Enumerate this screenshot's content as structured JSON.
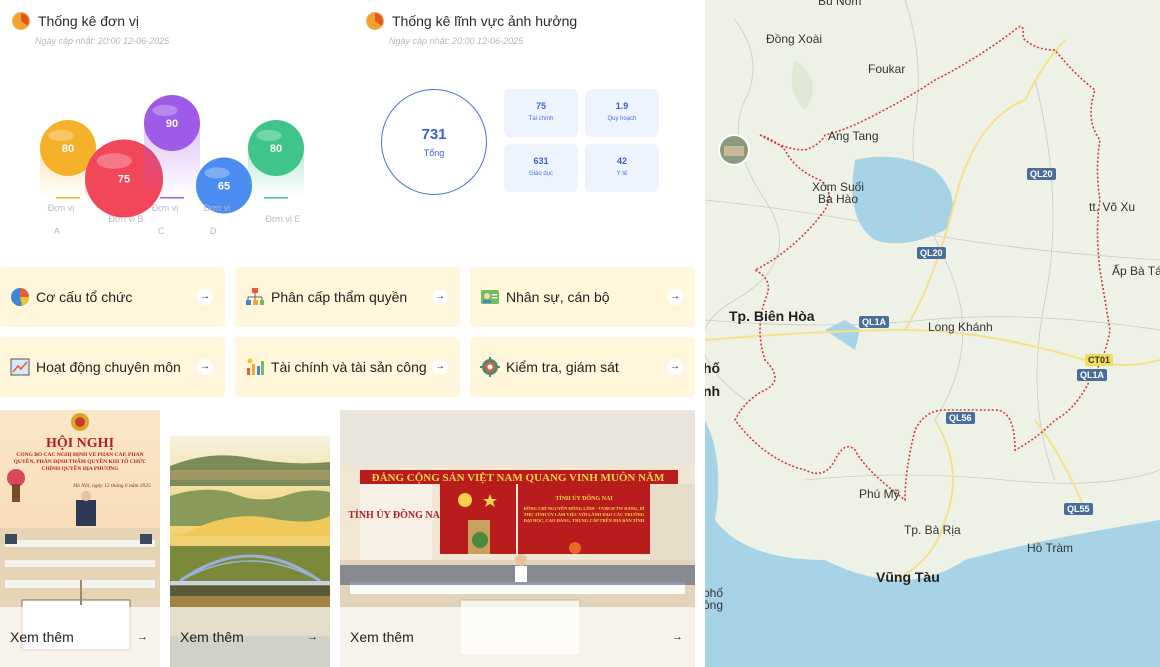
{
  "unit_stats": {
    "title": "Thống kê đơn vị",
    "updated": "Ngày cập nhật: 20:00 12-06-2025",
    "chart_data": {
      "type": "bar",
      "categories": [
        "Đơn vị A",
        "Đơn vị B",
        "Đơn vị C",
        "Đơn vị D",
        "Đơn vị E"
      ],
      "values": [
        80,
        75,
        90,
        65,
        80
      ],
      "colors": [
        "#f6b12a",
        "#f2465b",
        "#9f5ae8",
        "#4a8cf0",
        "#3fc48a"
      ],
      "ylim": [
        0,
        100
      ],
      "title": "",
      "xlabel": "",
      "ylabel": ""
    }
  },
  "field_stats": {
    "title": "Thống kê lĩnh vực ảnh hưởng",
    "updated": "Ngày cập nhật: 20:00 12-06-2025",
    "total_value": "731",
    "total_label": "Tổng",
    "items": [
      {
        "value": "75",
        "label": "Tài chính"
      },
      {
        "value": "1.9",
        "label": "Quy hoạch"
      },
      {
        "value": "631",
        "label": "Giáo dục"
      },
      {
        "value": "42",
        "label": "Y tế"
      }
    ]
  },
  "menu": [
    {
      "label": "Cơ cấu tổ chức",
      "icon": "pie-chart-icon"
    },
    {
      "label": "Phân cấp thẩm quyền",
      "icon": "org-hierarchy-icon"
    },
    {
      "label": "Nhân sự, cán bộ",
      "icon": "staff-card-icon"
    },
    {
      "label": "Hoạt động chuyên môn",
      "icon": "line-chart-icon"
    },
    {
      "label": "Tài chính và tài sản công",
      "icon": "finance-chart-icon"
    },
    {
      "label": "Kiểm tra, giám sát",
      "icon": "inspection-gear-icon"
    }
  ],
  "menu_arrow": "→",
  "cards": [
    {
      "more_label": "Xem thêm",
      "banner_title": "HỘI NGHỊ",
      "banner_sub": "CÔNG BỐ CÁC NGHỊ ĐỊNH VỀ PHÂN CẤP, PHÂN QUYỀN, PHÂN ĐỊNH THẨM QUYỀN KHI TỔ CHỨC CHÍNH QUYỀN ĐỊA PHƯƠNG",
      "banner_date": "Hà Nội, ngày 12 tháng 6 năm 2025"
    },
    {
      "more_label": "Xem thêm"
    },
    {
      "more_label": "Xem thêm",
      "banner_slogan": "ĐẢNG CỘNG SẢN VIỆT NAM QUANG VINH MUÔN NĂM",
      "left_sign": "TỈNH ỦY ĐỒNG NAI",
      "right_title": "TỈNH ỦY ĐỒNG NAI",
      "right_sub": "ĐỒNG CHÍ NGUYỄN HỒNG LĨNH - UVBCH TW ĐẢNG, BÍ THƯ TỈNH ỦY LÀM VIỆC VỚI LÃNH ĐẠO CÁC TRƯỜNG ĐẠI HỌC, CAO ĐẲNG, TRUNG CẤP TRÊN ĐỊA BÀN TỈNH"
    }
  ],
  "map": {
    "places": [
      {
        "name": "Bù Nốm",
        "big": false
      },
      {
        "name": "Đồng Xoài",
        "big": false
      },
      {
        "name": "Foukar",
        "big": false
      },
      {
        "name": "Ang Tang",
        "big": false
      },
      {
        "name": "Xóm Suối",
        "big": false
      },
      {
        "name": "Bà Hào",
        "big": false
      },
      {
        "name": "tt. Võ Xu",
        "big": false
      },
      {
        "name": "Ấp Bà Tá",
        "big": false
      },
      {
        "name": "Tp. Biên Hòa",
        "big": true
      },
      {
        "name": "Long Khánh",
        "big": false
      },
      {
        "name": "hố",
        "big": true
      },
      {
        "name": "nh",
        "big": true
      },
      {
        "name": "Phú Mỹ",
        "big": false
      },
      {
        "name": "Tp. Bà Rịa",
        "big": false
      },
      {
        "name": "Hồ Tràm",
        "big": false
      },
      {
        "name": "Vũng Tàu",
        "big": true
      },
      {
        "name": "phố",
        "big": false
      },
      {
        "name": "ồng",
        "big": false
      }
    ],
    "roads": [
      {
        "name": "QL20",
        "style": "blue"
      },
      {
        "name": "QL20",
        "style": "blue"
      },
      {
        "name": "QL1A",
        "style": "blue"
      },
      {
        "name": "CT01",
        "style": "yellow"
      },
      {
        "name": "QL1A",
        "style": "blue"
      },
      {
        "name": "QL56",
        "style": "blue"
      },
      {
        "name": "QL55",
        "style": "blue"
      }
    ]
  }
}
